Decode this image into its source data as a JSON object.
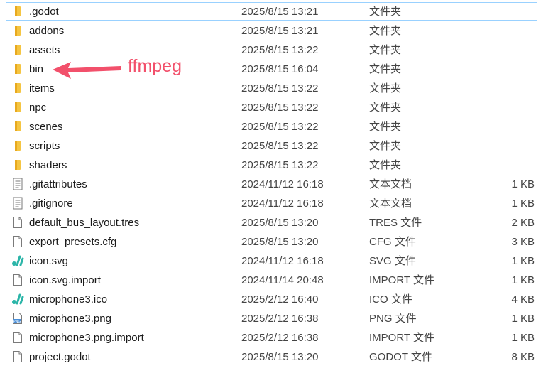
{
  "files": [
    {
      "name": ".godot",
      "date": "2025/8/15 13:21",
      "type": "文件夹",
      "size": "",
      "icon": "folder-icon",
      "selected": true
    },
    {
      "name": "addons",
      "date": "2025/8/15 13:21",
      "type": "文件夹",
      "size": "",
      "icon": "folder-icon"
    },
    {
      "name": "assets",
      "date": "2025/8/15 13:22",
      "type": "文件夹",
      "size": "",
      "icon": "folder-icon"
    },
    {
      "name": "bin",
      "date": "2025/8/15 16:04",
      "type": "文件夹",
      "size": "",
      "icon": "folder-icon"
    },
    {
      "name": "items",
      "date": "2025/8/15 13:22",
      "type": "文件夹",
      "size": "",
      "icon": "folder-icon"
    },
    {
      "name": "npc",
      "date": "2025/8/15 13:22",
      "type": "文件夹",
      "size": "",
      "icon": "folder-icon"
    },
    {
      "name": "scenes",
      "date": "2025/8/15 13:22",
      "type": "文件夹",
      "size": "",
      "icon": "folder-icon"
    },
    {
      "name": "scripts",
      "date": "2025/8/15 13:22",
      "type": "文件夹",
      "size": "",
      "icon": "folder-icon"
    },
    {
      "name": "shaders",
      "date": "2025/8/15 13:22",
      "type": "文件夹",
      "size": "",
      "icon": "folder-icon"
    },
    {
      "name": ".gitattributes",
      "date": "2024/11/12 16:18",
      "type": "文本文档",
      "size": "1 KB",
      "icon": "text-document-icon"
    },
    {
      "name": ".gitignore",
      "date": "2024/11/12 16:18",
      "type": "文本文档",
      "size": "1 KB",
      "icon": "text-document-icon"
    },
    {
      "name": "default_bus_layout.tres",
      "date": "2025/8/15 13:20",
      "type": "TRES 文件",
      "size": "2 KB",
      "icon": "blank-file-icon"
    },
    {
      "name": "export_presets.cfg",
      "date": "2025/8/15 13:20",
      "type": "CFG 文件",
      "size": "3 KB",
      "icon": "blank-file-icon"
    },
    {
      "name": "icon.svg",
      "date": "2024/11/12 16:18",
      "type": "SVG 文件",
      "size": "1 KB",
      "icon": "svg-app-icon"
    },
    {
      "name": "icon.svg.import",
      "date": "2024/11/14 20:48",
      "type": "IMPORT 文件",
      "size": "1 KB",
      "icon": "blank-file-icon"
    },
    {
      "name": "microphone3.ico",
      "date": "2025/2/12 16:40",
      "type": "ICO 文件",
      "size": "4 KB",
      "icon": "svg-app-icon"
    },
    {
      "name": "microphone3.png",
      "date": "2025/2/12 16:38",
      "type": "PNG 文件",
      "size": "1 KB",
      "icon": "png-image-icon"
    },
    {
      "name": "microphone3.png.import",
      "date": "2025/2/12 16:38",
      "type": "IMPORT 文件",
      "size": "1 KB",
      "icon": "blank-file-icon"
    },
    {
      "name": "project.godot",
      "date": "2025/8/15 13:20",
      "type": "GODOT 文件",
      "size": "8 KB",
      "icon": "blank-file-icon"
    }
  ],
  "annotation": {
    "label": "ffmpeg",
    "color": "#f2506b",
    "target": "bin"
  },
  "colors": {
    "folder": "#f5c542",
    "selection_border": "#99d1ff",
    "png_badge": "#4a8fd8"
  },
  "icons": {
    "png_badge_text": "PNG"
  }
}
